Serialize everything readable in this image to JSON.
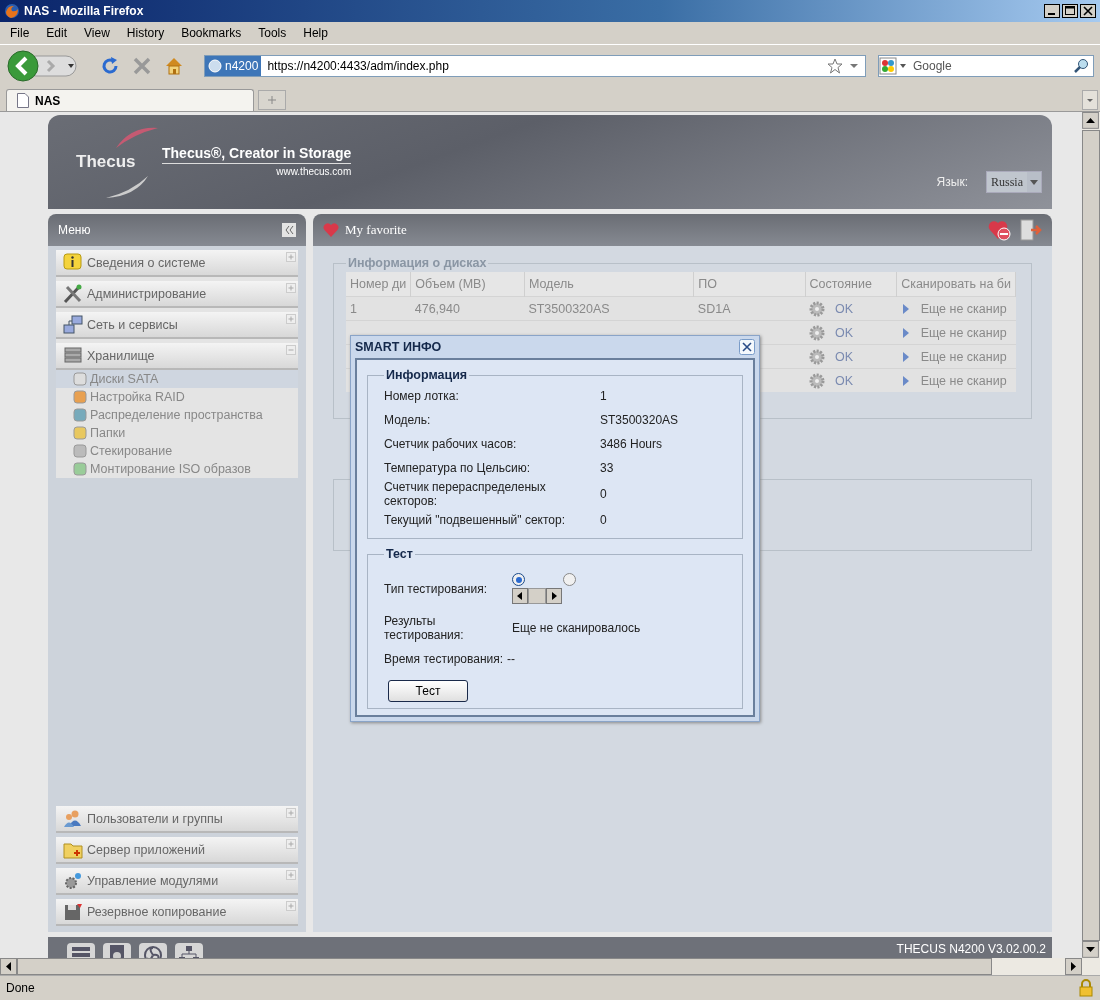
{
  "browser": {
    "title": "NAS - Mozilla Firefox",
    "menu": [
      "File",
      "Edit",
      "View",
      "History",
      "Bookmarks",
      "Tools",
      "Help"
    ],
    "address": {
      "badge": "n4200",
      "url": "https://n4200:4433/adm/index.php"
    },
    "search": {
      "placeholder": "Google"
    },
    "tabs": [
      {
        "label": "NAS",
        "selected": true
      }
    ],
    "status": "Done"
  },
  "header": {
    "logo": "Thecus",
    "tagline": "Thecus®, Creator in Storage",
    "site": "www.thecus.com",
    "language_label": "Язык:",
    "language": "Russia"
  },
  "menu": {
    "title": "Меню",
    "groups": [
      {
        "label": "Сведения о системе",
        "expanded": false
      },
      {
        "label": "Администрирование",
        "expanded": false
      },
      {
        "label": "Сеть и сервисы",
        "expanded": false
      },
      {
        "label": "Хранилище",
        "expanded": true,
        "children": [
          {
            "label": "Диски SATA",
            "selected": true
          },
          {
            "label": "Настройка RAID",
            "selected": false
          },
          {
            "label": "Распределение пространства",
            "selected": false
          },
          {
            "label": "Папки",
            "selected": false
          },
          {
            "label": "Стекирование",
            "selected": false
          },
          {
            "label": "Монтирование ISO образов",
            "selected": false
          }
        ]
      }
    ],
    "bottom_groups": [
      {
        "label": "Пользователи и группы",
        "expanded": false
      },
      {
        "label": "Сервер приложений",
        "expanded": false
      },
      {
        "label": "Управление модулями",
        "expanded": false
      },
      {
        "label": "Резервное копирование",
        "expanded": false
      }
    ]
  },
  "favorites": {
    "title": "My favorite"
  },
  "disks": {
    "title": "Информация о дисках",
    "columns": [
      "Номер ди",
      "Объем (MB)",
      "Модель",
      "ПО",
      "Состояние",
      "Сканировать на би"
    ],
    "rows": [
      {
        "number": "1",
        "size": "476,940",
        "model": "ST3500320AS",
        "firmware": "SD1A",
        "status": "OK",
        "scan": "Еще не сканир"
      },
      {
        "status": "OK",
        "scan": "Еще не сканир"
      },
      {
        "status": "OK",
        "scan": "Еще не сканир"
      },
      {
        "status": "OK",
        "scan": "Еще не сканир"
      }
    ]
  },
  "footer": {
    "version": "THECUS N4200 V3.02.00.2"
  },
  "dialog": {
    "title": "SMART ИНФО",
    "info": {
      "title": "Информация",
      "rows": [
        {
          "label": "Номер лотка:",
          "value": "1"
        },
        {
          "label": "Модель:",
          "value": "ST3500320AS"
        },
        {
          "label": "Счетчик рабочих часов:",
          "value": "3486 Hours"
        },
        {
          "label": "Температура по Цельсию:",
          "value": "33"
        },
        {
          "label": "Счетчик перераспределеных секторов:",
          "value": "0"
        },
        {
          "label": "Текущий \"подвешенный\" сектор:",
          "value": "0"
        }
      ]
    },
    "test": {
      "title": "Тест",
      "type_label": "Тип тестирования:",
      "options": [
        {
          "selected": true
        },
        {
          "selected": false
        }
      ],
      "results_label": "Результы тестирования:",
      "results_value": "Еще не сканировалось",
      "time_label": "Время тестирования:",
      "time_value": "--",
      "button": "Тест"
    }
  }
}
